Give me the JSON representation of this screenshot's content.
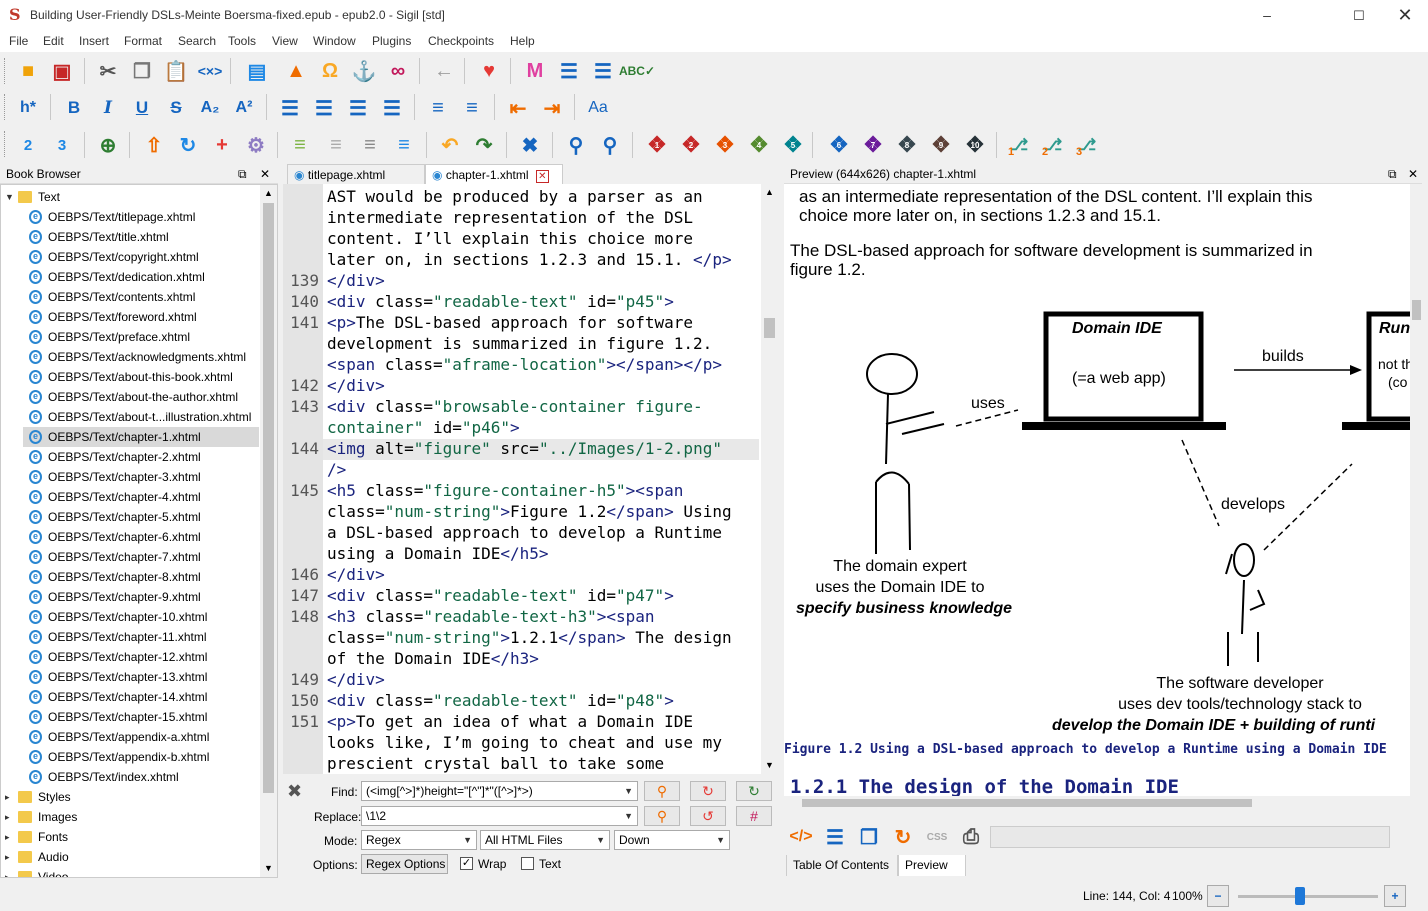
{
  "window": {
    "title": "Building User-Friendly DSLs-Meinte Boersma-fixed.epub - epub2.0 - Sigil [std]",
    "app_icon_glyph": "S"
  },
  "menu": [
    "File",
    "Edit",
    "Insert",
    "Format",
    "Search",
    "Tools",
    "View",
    "Window",
    "Plugins",
    "Checkpoints",
    "Help"
  ],
  "toolbar": {
    "heading_label": "h*",
    "bold": "B",
    "italic": "I",
    "underline": "U",
    "strike": "S",
    "subscript": "A₂",
    "superscript": "A²",
    "case_label": "Aa",
    "puzzle_numbers": [
      "1",
      "2",
      "3",
      "4",
      "5",
      "6",
      "7",
      "8",
      "9",
      "10"
    ],
    "puzzle_colors": [
      "#c62828",
      "#c62828",
      "#e65100",
      "#558b2f",
      "#00838f",
      "#1565c0",
      "#6a1b9a",
      "#37474f",
      "#5d4037",
      "#263238"
    ],
    "tree_numbers": [
      "1",
      "2",
      "3"
    ]
  },
  "book_browser": {
    "title": "Book Browser",
    "root_folder": "Text",
    "files": [
      "OEBPS/Text/titlepage.xhtml",
      "OEBPS/Text/title.xhtml",
      "OEBPS/Text/copyright.xhtml",
      "OEBPS/Text/dedication.xhtml",
      "OEBPS/Text/contents.xhtml",
      "OEBPS/Text/foreword.xhtml",
      "OEBPS/Text/preface.xhtml",
      "OEBPS/Text/acknowledgments.xhtml",
      "OEBPS/Text/about-this-book.xhtml",
      "OEBPS/Text/about-the-author.xhtml",
      "OEBPS/Text/about-t...illustration.xhtml",
      "OEBPS/Text/chapter-1.xhtml",
      "OEBPS/Text/chapter-2.xhtml",
      "OEBPS/Text/chapter-3.xhtml",
      "OEBPS/Text/chapter-4.xhtml",
      "OEBPS/Text/chapter-5.xhtml",
      "OEBPS/Text/chapter-6.xhtml",
      "OEBPS/Text/chapter-7.xhtml",
      "OEBPS/Text/chapter-8.xhtml",
      "OEBPS/Text/chapter-9.xhtml",
      "OEBPS/Text/chapter-10.xhtml",
      "OEBPS/Text/chapter-11.xhtml",
      "OEBPS/Text/chapter-12.xhtml",
      "OEBPS/Text/chapter-13.xhtml",
      "OEBPS/Text/chapter-14.xhtml",
      "OEBPS/Text/chapter-15.xhtml",
      "OEBPS/Text/appendix-a.xhtml",
      "OEBPS/Text/appendix-b.xhtml",
      "OEBPS/Text/index.xhtml"
    ],
    "selected_index": 11,
    "other_folders": [
      "Styles",
      "Images",
      "Fonts",
      "Audio",
      "Video"
    ]
  },
  "editor_tabs": [
    {
      "label": "titlepage.xhtml"
    },
    {
      "label": "chapter-1.xhtml"
    }
  ],
  "code_lines": [
    {
      "n": "",
      "html": "AST would be produced by a parser as an"
    },
    {
      "n": "",
      "html": "intermediate representation of the DSL"
    },
    {
      "n": "",
      "html": "content. I’ll explain this choice more"
    },
    {
      "n": "",
      "html": "later on, in sections 1.2.3 and 15.1. <t></p></t>"
    },
    {
      "n": "139",
      "html": "<t></div></t>"
    },
    {
      "n": "140",
      "html": "<t><div</t> <a>class=</a><s>\"readable-text\"</s> <a>id=</a><s>\"p45\"</s><t>></t>"
    },
    {
      "n": "141",
      "html": "<t><p></t>The DSL-based approach for software"
    },
    {
      "n": "",
      "html": "development is summarized in figure 1.2."
    },
    {
      "n": "",
      "html": "<t><span</t> <a>class=</a><s>\"aframe-location\"</s><t>></span></p></t>"
    },
    {
      "n": "142",
      "html": "<t></div></t>"
    },
    {
      "n": "143",
      "html": "<t><div</t> <a>class=</a><s>\"browsable-container figure-</s>"
    },
    {
      "n": "",
      "html": "<s>container\"</s> <a>id=</a><s>\"p46\"</s><t>></t>"
    },
    {
      "n": "144",
      "html": "<t><img</t> <a>alt=</a><s>\"figure\"</s> <a>src=</a><s>\"../Images/1-2.png\"</s>"
    },
    {
      "n": "",
      "html": "<t>/></t>"
    },
    {
      "n": "145",
      "html": "<t><h5</t> <a>class=</a><s>\"figure-container-h5\"</s><t>><span</t>"
    },
    {
      "n": "",
      "html": "<a>class=</a><s>\"num-string\"</s><t>></t>Figure 1.2<t></span></t> Using"
    },
    {
      "n": "",
      "html": "a DSL-based approach to develop a Runtime"
    },
    {
      "n": "",
      "html": "using a Domain IDE<t></h5></t>"
    },
    {
      "n": "146",
      "html": "<t></div></t>"
    },
    {
      "n": "147",
      "html": "<t><div</t> <a>class=</a><s>\"readable-text\"</s> <a>id=</a><s>\"p47\"</s><t>></t>"
    },
    {
      "n": "148",
      "html": "<t><h3</t> <a>class=</a><s>\"readable-text-h3\"</s><t>><span</t>"
    },
    {
      "n": "",
      "html": "<a>class=</a><s>\"num-string\"</s><t>></t>1.2.1<t></span></t> The design"
    },
    {
      "n": "",
      "html": "of the Domain IDE<t></h3></t>"
    },
    {
      "n": "149",
      "html": "<t></div></t>"
    },
    {
      "n": "150",
      "html": "<t><div</t> <a>class=</a><s>\"readable-text\"</s> <a>id=</a><s>\"p48\"</s><t>></t>"
    },
    {
      "n": "151",
      "html": "<t><p></t>To get an idea of what a Domain IDE"
    },
    {
      "n": "",
      "html": "looks like, I’m going to cheat and use my"
    },
    {
      "n": "",
      "html": "prescient crystal ball to take some"
    }
  ],
  "highlight_row": 12,
  "preview": {
    "title": "Preview (644x626) chapter-1.xhtml",
    "para1_line1": "as an intermediate representation of the DSL content. I’ll explain this",
    "para1_line2": "choice more later on, in sections 1.2.3 and 15.1.",
    "para2_line1": "The DSL-based approach for software development is summarized in",
    "para2_line2": "figure 1.2.",
    "fig": {
      "domain_ide_title": "Domain IDE",
      "domain_ide_sub": "(=a web app)",
      "runtime_title": "Runt",
      "runtime_sub1": "not th",
      "runtime_sub2": "(co",
      "builds": "builds",
      "uses": "uses",
      "develops": "develops",
      "expert_l1": "The domain expert",
      "expert_l2": "uses the Domain IDE to",
      "expert_l3": "specify business knowledge",
      "dev_l1": "The software developer",
      "dev_l2": "uses dev tools/technology stack to",
      "dev_l3": "develop the Domain IDE + building of runti"
    },
    "caption": "Figure 1.2 Using a DSL-based approach to develop a Runtime using a Domain IDE",
    "heading": "1.2.1 The design of the Domain IDE"
  },
  "find_replace": {
    "find_label": "Find:",
    "find_value": "(<img[^>]*)height=\"[^\"]*\"([^>]*>)",
    "replace_label": "Replace:",
    "replace_value": "\\1\\2",
    "mode_label": "Mode:",
    "mode_value": "Regex",
    "scope_value": "All HTML Files",
    "direction_value": "Down",
    "options_label": "Options:",
    "regex_options_button": "Regex Options",
    "wrap_label": "Wrap",
    "text_label": "Text",
    "count_symbol": "#"
  },
  "bottom_tabs": [
    "Table Of Contents",
    "Preview"
  ],
  "status": {
    "position": "Line: 144, Col: 4",
    "zoom": "100%",
    "zoom_slider_fraction": 0.44
  }
}
